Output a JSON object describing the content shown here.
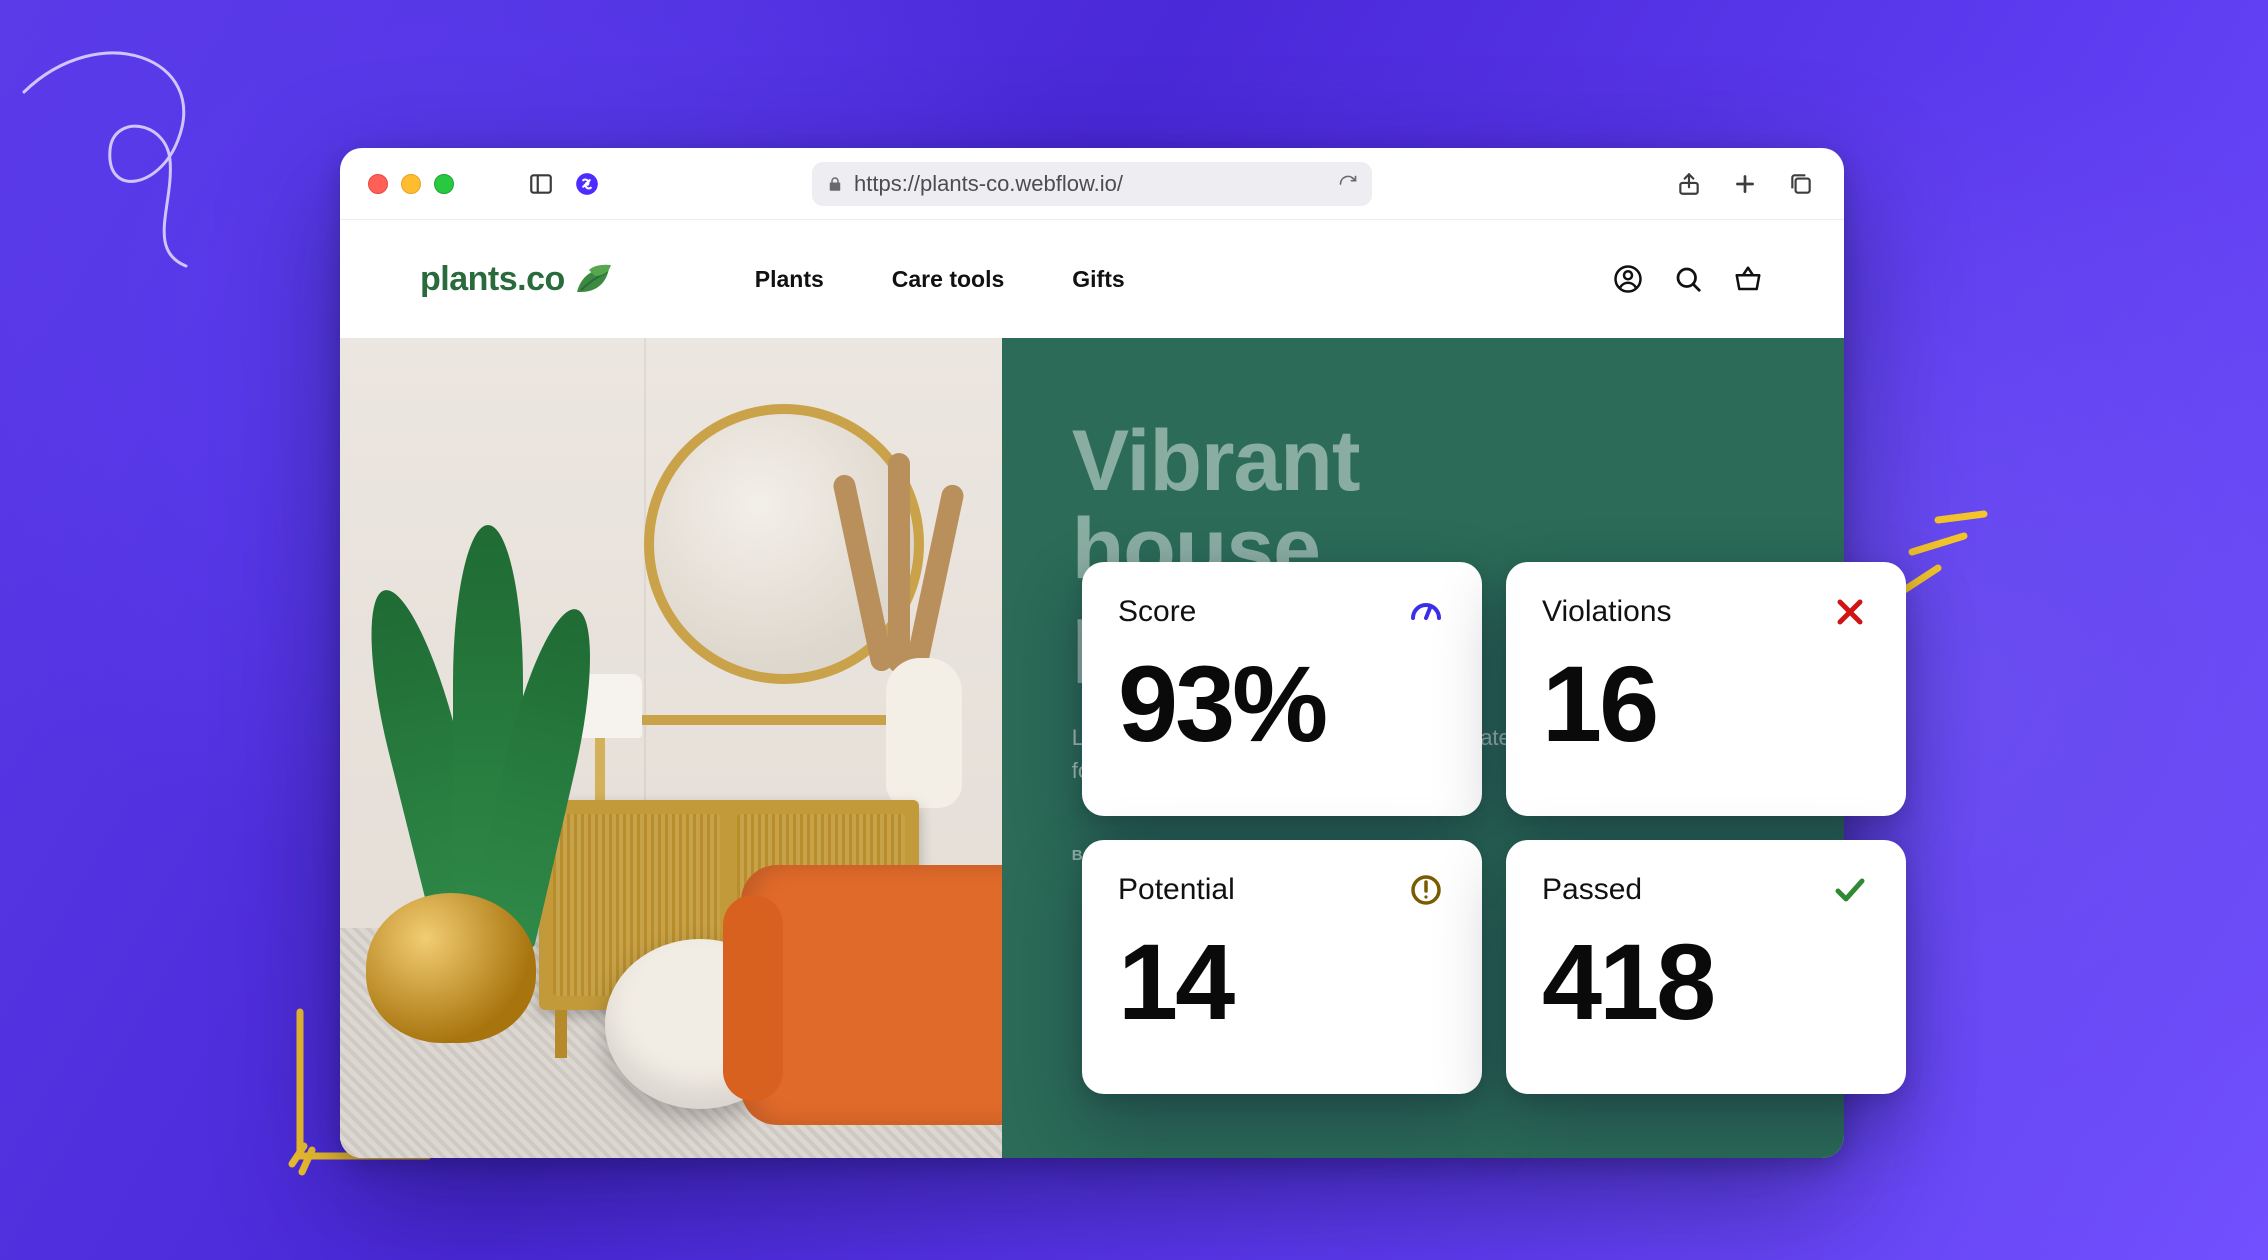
{
  "browser": {
    "url": "https://plants-co.webflow.io/"
  },
  "site": {
    "logo_text": "plants.co",
    "nav": {
      "plants": "Plants",
      "care_tools": "Care tools",
      "gifts": "Gifts"
    }
  },
  "hero": {
    "title_line1": "Vibrant",
    "title_line2": "house",
    "title_line3": "plants",
    "subtitle": "Lighten your home with our personally curated, only for you.",
    "cta": "BROWSE THE"
  },
  "stats": {
    "score": {
      "label": "Score",
      "value": "93%"
    },
    "violations": {
      "label": "Violations",
      "value": "16"
    },
    "potential": {
      "label": "Potential",
      "value": "14"
    },
    "passed": {
      "label": "Passed",
      "value": "418"
    }
  }
}
